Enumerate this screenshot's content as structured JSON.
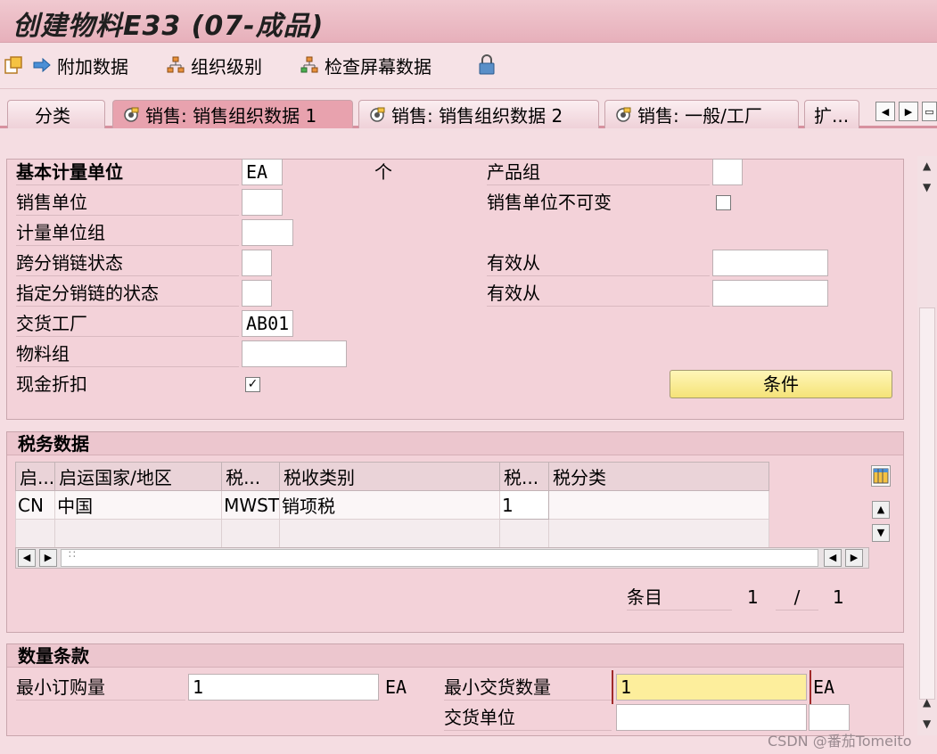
{
  "window": {
    "title": "创建物料E33 (07-成品)"
  },
  "toolbar": {
    "additional_data": "附加数据",
    "org_levels": "组织级别",
    "check_screen_data": "检查屏幕数据"
  },
  "tabs": [
    {
      "label": "分类"
    },
    {
      "label": "销售: 销售组织数据 1"
    },
    {
      "label": "销售: 销售组织数据 2"
    },
    {
      "label": "销售: 一般/工厂"
    },
    {
      "label": "扩..."
    }
  ],
  "general": {
    "base_uom_label": "基本计量单位",
    "base_uom_value": "EA",
    "base_uom_text": "个",
    "sales_unit_label": "销售单位",
    "uom_group_label": "计量单位组",
    "xchain_status_label": "跨分销链状态",
    "dchain_status_label": "指定分销链的状态",
    "delivering_plant_label": "交货工厂",
    "delivering_plant_value": "AB01",
    "material_group_label": "物料组",
    "cash_discount_label": "现金折扣",
    "division_label": "产品组",
    "sales_unit_fixed_label": "销售单位不可变",
    "valid_from_label_1": "有效从",
    "valid_from_label_2": "有效从",
    "conditions_button": "条件"
  },
  "tax": {
    "title": "税务数据",
    "columns": [
      "启...",
      "启运国家/地区",
      "税...",
      "税收类别",
      "税...",
      "税分类"
    ],
    "rows": [
      [
        "CN",
        "中国",
        "MWST",
        "销项税",
        "1",
        ""
      ],
      [
        "",
        "",
        "",
        "",
        "",
        ""
      ]
    ],
    "entry_label": "条目",
    "entry_current": "1",
    "entry_sep": "/",
    "entry_total": "1"
  },
  "quantity": {
    "title": "数量条款",
    "min_order_label": "最小订购量",
    "min_order_value": "1",
    "min_order_unit": "EA",
    "min_delivery_label": "最小交货数量",
    "min_delivery_value": "1",
    "min_delivery_unit": "EA",
    "delivery_unit_label": "交货单位"
  },
  "watermark": "CSDN @番茄Tomeito"
}
